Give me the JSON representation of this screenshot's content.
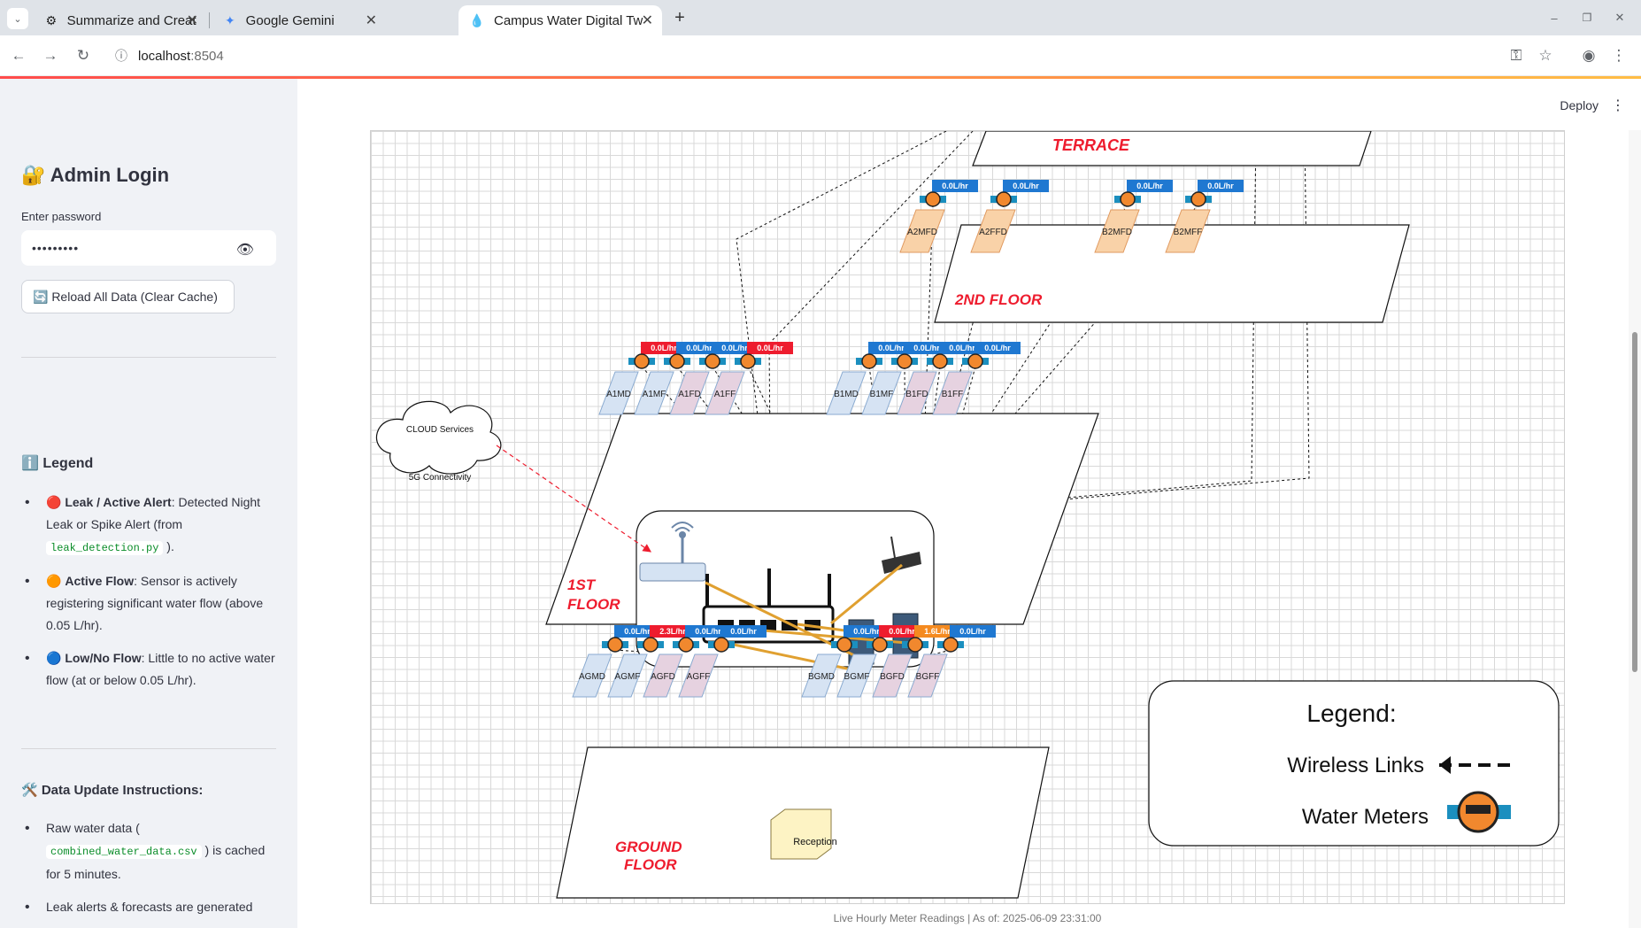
{
  "browser": {
    "tabs": [
      {
        "label": "Summarize and Create Ti",
        "icon": "openai-icon"
      },
      {
        "label": "Google Gemini",
        "icon": "gemini-icon"
      },
      {
        "label": "Campus Water Digital Tw",
        "icon": "water-drop-icon"
      }
    ],
    "url_host": "localhost",
    "url_port": ":8504"
  },
  "sidebar": {
    "title": "🔐 Admin Login",
    "password_label": "Enter password",
    "password_value": "•••••••••",
    "reload_button": "🔄 Reload All Data (Clear Cache)",
    "legend_title": "ℹ️ Legend",
    "legend_items": [
      {
        "emoji": "🔴",
        "bold": "Leak / Active Alert",
        "text": ": Detected Night Leak or Spike Alert (from ",
        "code": "leak_detection.py",
        "tail": " )."
      },
      {
        "emoji": "🟠",
        "bold": "Active Flow",
        "text": ": Sensor is actively registering significant water flow (above 0.05 L/hr)."
      },
      {
        "emoji": "🔵",
        "bold": "Low/No Flow",
        "text": ": Little to no active water flow (at or below 0.05 L/hr)."
      }
    ],
    "instructions_title": "🛠️ Data Update Instructions:",
    "instructions": [
      {
        "pre": "Raw water data ( ",
        "code": "combined_water_data.csv",
        "post": " ) is cached for 5 minutes."
      },
      {
        "pre": "Leak alerts & forecasts are generated",
        "code": "",
        "post": ""
      }
    ]
  },
  "header": {
    "deploy_label": "Deploy"
  },
  "diagram": {
    "floors": {
      "terrace": "TERRACE",
      "second": "2ND FLOOR",
      "first_1": "1ST",
      "first_2": "FLOOR",
      "ground_1": "GROUND",
      "ground_2": "FLOOR"
    },
    "cloud_label": "CLOUD Services",
    "connectivity_label": "5G Connectivity",
    "reception_label": "Reception",
    "legend_title": "Legend:",
    "legend_wireless": "Wireless Links",
    "legend_meters": "Water Meters",
    "meters": {
      "second": [
        {
          "name": "A2MFD",
          "reading": "0.0L/hr",
          "status": "low"
        },
        {
          "name": "A2FFD",
          "reading": "0.0L/hr",
          "status": "low"
        },
        {
          "name": "B2MFD",
          "reading": "0.0L/hr",
          "status": "low"
        },
        {
          "name": "B2MFF",
          "reading": "0.0L/hr",
          "status": "low"
        }
      ],
      "first_a": [
        {
          "name": "A1MD",
          "reading": "0.0L/hr",
          "status": "leak"
        },
        {
          "name": "A1MF",
          "reading": "0.0L/hr",
          "status": "low"
        },
        {
          "name": "A1FD",
          "reading": "0.0L/hr",
          "status": "low"
        },
        {
          "name": "A1FF",
          "reading": "0.0L/hr",
          "status": "leak"
        }
      ],
      "first_b": [
        {
          "name": "B1MD",
          "reading": "0.0L/hr",
          "status": "low"
        },
        {
          "name": "B1MF",
          "reading": "0.0L/hr",
          "status": "low"
        },
        {
          "name": "B1FD",
          "reading": "0.0L/hr",
          "status": "low"
        },
        {
          "name": "B1FF",
          "reading": "0.0L/hr",
          "status": "low"
        }
      ],
      "ground_a": [
        {
          "name": "AGMD",
          "reading": "0.0L/hr",
          "status": "low"
        },
        {
          "name": "AGMF",
          "reading": "2.3L/hr",
          "status": "leak"
        },
        {
          "name": "AGFD",
          "reading": "0.0L/hr",
          "status": "low"
        },
        {
          "name": "AGFF",
          "reading": "0.0L/hr",
          "status": "low"
        }
      ],
      "ground_b": [
        {
          "name": "BGMD",
          "reading": "0.0L/hr",
          "status": "low"
        },
        {
          "name": "BGMF",
          "reading": "0.0L/hr",
          "status": "leak"
        },
        {
          "name": "BGFD",
          "reading": "1.6L/hr",
          "status": "active"
        },
        {
          "name": "BGFF",
          "reading": "0.0L/hr",
          "status": "low"
        }
      ]
    },
    "status_colors": {
      "low": "#1f78d1",
      "leak": "#ee1c2e",
      "active": "#f58a1f"
    }
  },
  "caption": "Live Hourly Meter Readings | As of: 2025-06-09 23:31:00"
}
